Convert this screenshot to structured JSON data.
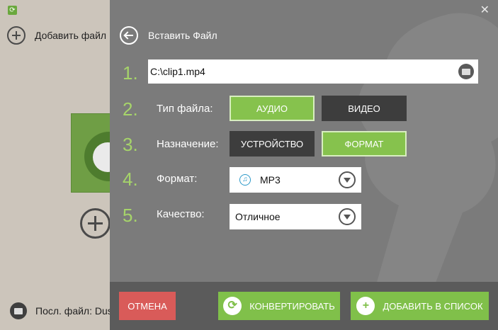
{
  "background": {
    "add_file_label": "Добавить файл",
    "last_file_label": "Посл. файл: Dus"
  },
  "panel": {
    "close_symbol": "✕",
    "header_title": "Вставить Файл",
    "steps": [
      "1.",
      "2.",
      "3.",
      "4.",
      "5."
    ],
    "file_path": "C:\\clip1.mp4",
    "file_type_label": "Тип файла:",
    "audio_label": "АУДИО",
    "video_label": "ВИДЕО",
    "destination_label": "Назначение:",
    "device_label": "УСТРОЙСТВО",
    "format_toggle_label": "ФОРМАТ",
    "format_label": "Формат:",
    "format_value": "MP3",
    "quality_label": "Качество:",
    "quality_value": "Отличное"
  },
  "footer": {
    "cancel_label": "ОТМЕНА",
    "convert_label": "КОНВЕРТИРОВАТЬ",
    "add_to_list_label": "ДОБАВИТЬ В СПИСОК"
  },
  "colors": {
    "accent_green": "#86c24d",
    "cancel_red": "#d95b59",
    "panel_gray": "#7b7b7b",
    "toggle_dark": "#3d3d3d"
  },
  "selected": {
    "file_type": "АУДИО",
    "destination": "ФОРМАТ"
  }
}
